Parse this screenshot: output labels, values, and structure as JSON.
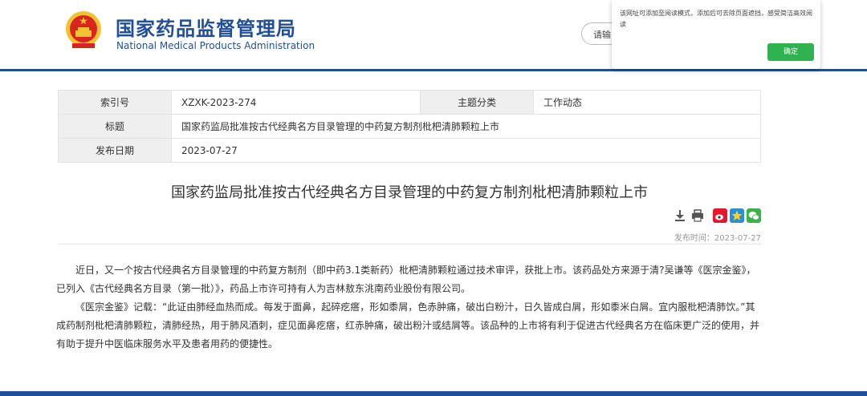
{
  "header": {
    "logo_cn": "国家药品监督管理局",
    "logo_en": "National Medical Products Administration",
    "search_placeholder": "请输"
  },
  "popup": {
    "message": "该网址可添加至阅读模式，添加后可去除页面遮挡，感受简洁高效阅读",
    "confirm_label": "确定",
    "confirm_color": "#2fb350"
  },
  "meta": {
    "index_label": "索引号",
    "index_value": "XZXK-2023-274",
    "category_label": "主题分类",
    "category_value": "工作动态",
    "title_label": "标题",
    "title_value": "国家药监局批准按古代经典名方目录管理的中药复方制剂枇杷清肺颗粒上市",
    "date_label": "发布日期",
    "date_value": "2023-07-27"
  },
  "article": {
    "title": "国家药监局批准按古代经典名方目录管理的中药复方制剂枇杷清肺颗粒上市",
    "publish_time": "发布时间：2023-07-27",
    "paragraphs": [
      "近日，又一个按古代经典名方目录管理的中药复方制剂（即中药3.1类新药）枇杷清肺颗粒通过技术审评，获批上市。该药品处方来源于清?吴谦等《医宗金鉴》，已列入《古代经典名方目录（第一批）》，药品上市许可持有人为吉林敖东洮南药业股份有限公司。",
      "《医宗金鉴》记载：“此证由肺经血热而成。每发于面鼻，起碎疙瘩，形如黍屑，色赤肿痛，破出白粉汁，日久皆成白屑，形如黍米白屑。宜内服枇杷清肺饮。”其成药制剂枇杷清肺颗粒，清肺经热，用于肺风酒刺，症见面鼻疙瘩，红赤肿痛，破出粉汁或结屑等。该品种的上市将有利于促进古代经典名方在临床更广泛的使用，并有助于提升中医临床服务水平及患者用药的便捷性。"
    ]
  },
  "colors": {
    "brand_blue": "#1f4f9c",
    "emblem_red": "#d8261e",
    "emblem_gold": "#f2c230"
  },
  "icons": [
    "download-icon",
    "print-icon",
    "weibo-icon",
    "qzone-icon",
    "wechat-icon"
  ]
}
